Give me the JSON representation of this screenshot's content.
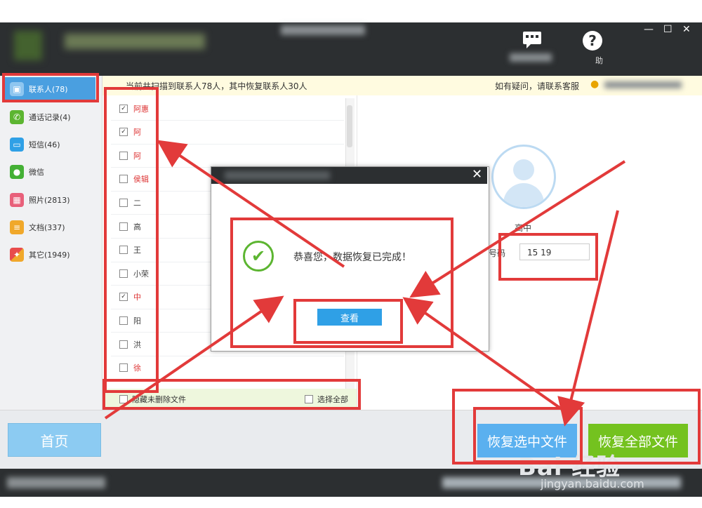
{
  "window": {
    "controls": [
      "—",
      "☐",
      "✕"
    ],
    "toolbar": [
      {
        "name": "contact-service",
        "icon": "chat-icon",
        "label": ""
      },
      {
        "name": "help",
        "icon": "help-icon",
        "label": "助"
      }
    ]
  },
  "notice": {
    "left_text": "当前共扫描到联系人78人，其中恢复联系人30人",
    "right_text": "如有疑问，请联系客服"
  },
  "sidebar": {
    "items": [
      {
        "label": "联系人(78)",
        "icon": "contacts-icon",
        "color": "#4a9fe0",
        "active": true
      },
      {
        "label": "通话记录(4)",
        "icon": "phone-icon",
        "color": "#5cb531"
      },
      {
        "label": "短信(46)",
        "icon": "sms-icon",
        "color": "#2fa0e6"
      },
      {
        "label": "微信",
        "icon": "wechat-icon",
        "color": "#44b035"
      },
      {
        "label": "照片(2813)",
        "icon": "photo-icon",
        "color": "#e8607a"
      },
      {
        "label": "文档(337)",
        "icon": "document-icon",
        "color": "#f0a82b"
      },
      {
        "label": "其它(1949)",
        "icon": "other-icon",
        "color": "#e84c4c"
      }
    ]
  },
  "contacts": [
    {
      "name": "阿惠",
      "checked": true,
      "red": true
    },
    {
      "name": "阿",
      "checked": true,
      "red": true
    },
    {
      "name": "阿",
      "checked": false,
      "red": true
    },
    {
      "name": "侯辑",
      "checked": false,
      "red": true
    },
    {
      "name": "二",
      "checked": false,
      "red": false
    },
    {
      "name": "高",
      "checked": false,
      "red": false
    },
    {
      "name": "王",
      "checked": false,
      "red": false
    },
    {
      "name": "小荣",
      "checked": false,
      "red": false
    },
    {
      "name": "中",
      "checked": true,
      "red": true
    },
    {
      "name": "阳",
      "checked": false,
      "red": false
    },
    {
      "name": "洪",
      "checked": false,
      "red": false
    },
    {
      "name": "徐",
      "checked": false,
      "red": true
    }
  ],
  "list_footer": {
    "hide_label": "隐藏未删除文件",
    "select_all_label": "选择全部"
  },
  "detail": {
    "name": "高中",
    "phone_label": "号码",
    "phone_value": "15        19"
  },
  "bottom": {
    "home_label": "首页",
    "restore_selected_label": "恢复选中文件",
    "restore_all_label": "恢复全部文件"
  },
  "dialog": {
    "close": "✕",
    "message": "恭喜您，数据恢复已完成！",
    "view_label": "查看",
    "check_icon": "check-icon"
  },
  "watermark": {
    "logo": "Bai 经验",
    "url": "jingyan.baidu.com"
  },
  "colors": {
    "annotation": "#e23a3a",
    "accent_blue": "#4a9fe0",
    "accent_green": "#74c21f"
  }
}
